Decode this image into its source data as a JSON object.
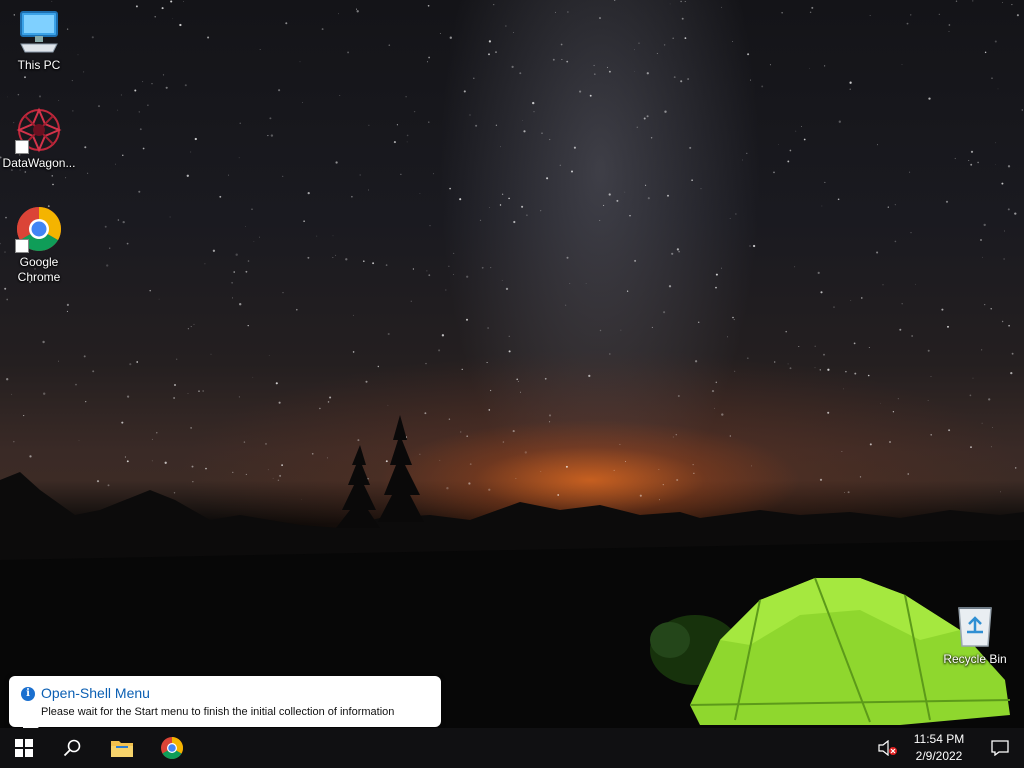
{
  "desktop": {
    "icons": [
      {
        "label": "This PC",
        "icon": "computer-icon"
      },
      {
        "label": "DataWagon...",
        "icon": "datawagon-icon"
      },
      {
        "label": "Google Chrome",
        "icon": "chrome-icon"
      },
      {
        "label": "Recycle Bin",
        "icon": "recycle-bin-icon"
      }
    ]
  },
  "notification": {
    "title": "Open-Shell Menu",
    "message": "Please wait for the Start menu to finish the initial collection of information",
    "icon": "info-icon"
  },
  "taskbar": {
    "buttons": [
      {
        "name": "start",
        "icon": "windows-logo-icon"
      },
      {
        "name": "search",
        "icon": "search-icon"
      },
      {
        "name": "file-explorer",
        "icon": "folder-icon"
      },
      {
        "name": "chrome",
        "icon": "chrome-icon"
      }
    ],
    "tray": {
      "volume_icon": "volume-muted-icon",
      "time": "11:54 PM",
      "date": "2/9/2022",
      "action_center_icon": "notification-icon"
    }
  }
}
